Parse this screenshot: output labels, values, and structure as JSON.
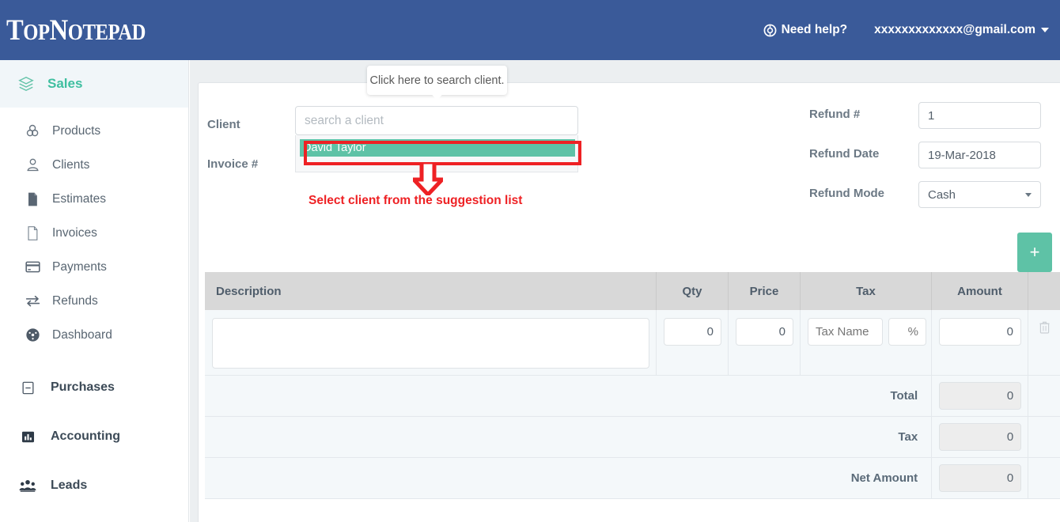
{
  "header": {
    "logo_top": "Top",
    "logo_note": "Notepad",
    "logo_full": "TopNotepad",
    "need_help": "Need help?",
    "help_icon": "lifebuoy-icon",
    "account_email": "xxxxxxxxxxxxx@gmail.com",
    "caret_icon": "chevron-down-icon",
    "bg_color": "#3a5a99"
  },
  "sidebar": {
    "group": {
      "label": "Sales",
      "icon": "layers-icon",
      "active": true,
      "accent": "#3fbfa0"
    },
    "sub_items": [
      {
        "label": "Products",
        "icon": "boxes-icon"
      },
      {
        "label": "Clients",
        "icon": "user-icon"
      },
      {
        "label": "Estimates",
        "icon": "file-filled-icon"
      },
      {
        "label": "Invoices",
        "icon": "file-outline-icon"
      },
      {
        "label": "Payments",
        "icon": "credit-card-icon"
      },
      {
        "label": "Refunds",
        "icon": "exchange-arrows-icon"
      },
      {
        "label": "Dashboard",
        "icon": "gauge-icon"
      }
    ],
    "top_items": [
      {
        "label": "Purchases",
        "icon": "minus-box-icon"
      },
      {
        "label": "Accounting",
        "icon": "bar-chart-icon"
      },
      {
        "label": "Leads",
        "icon": "people-icon"
      }
    ]
  },
  "tooltip": {
    "text": "Click here to search client."
  },
  "annotation": {
    "note": "Select client from the suggestion list",
    "color": "#ee2124",
    "arrow_icon": "down-arrow-annotation-icon"
  },
  "form": {
    "client_label": "Client",
    "client_placeholder": "search a client",
    "client_value": "",
    "suggestion": "David Taylor",
    "invoice_label": "Invoice #",
    "refund_no_label": "Refund #",
    "refund_no_value": "1",
    "refund_date_label": "Refund Date",
    "refund_date_value": "19-Mar-2018",
    "refund_mode_label": "Refund Mode",
    "refund_mode_value": "Cash"
  },
  "actions": {
    "add_row_label": "+",
    "add_row_icon": "plus-icon",
    "delete_row_icon": "trash-icon",
    "accent": "#5ec2a6"
  },
  "table": {
    "columns": [
      "Description",
      "Qty",
      "Price",
      "Tax",
      "Amount"
    ],
    "row": {
      "description": "",
      "qty": "0",
      "price": "0",
      "tax_name": "",
      "tax_name_placeholder": "Tax Name",
      "tax_pct": "",
      "tax_pct_placeholder": "%",
      "amount": "0"
    },
    "totals": [
      {
        "label": "Total",
        "value": "0"
      },
      {
        "label": "Tax",
        "value": "0"
      },
      {
        "label": "Net Amount",
        "value": "0"
      }
    ]
  }
}
